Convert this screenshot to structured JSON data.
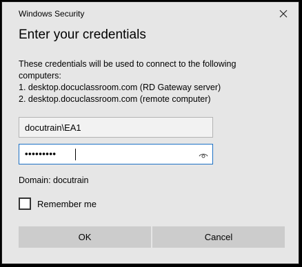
{
  "window": {
    "title": "Windows Security",
    "close_icon": "close-icon"
  },
  "dialog": {
    "heading": "Enter your credentials",
    "description_lines": [
      "These credentials will be used to connect to the following",
      "computers:",
      "1. desktop.docuclassroom.com (RD Gateway server)",
      "2. desktop.docuclassroom.com (remote computer)"
    ],
    "username_value": "docutrain\\EA1",
    "password_masked": "•••••••••",
    "reveal_icon": "eye-icon",
    "domain_text": "Domain: docutrain",
    "remember_label": "Remember me",
    "remember_checked": false,
    "ok_label": "OK",
    "cancel_label": "Cancel"
  },
  "colors": {
    "background": "#e6e6e6",
    "focus_border": "#1a6fc4",
    "button": "#cccccc"
  }
}
